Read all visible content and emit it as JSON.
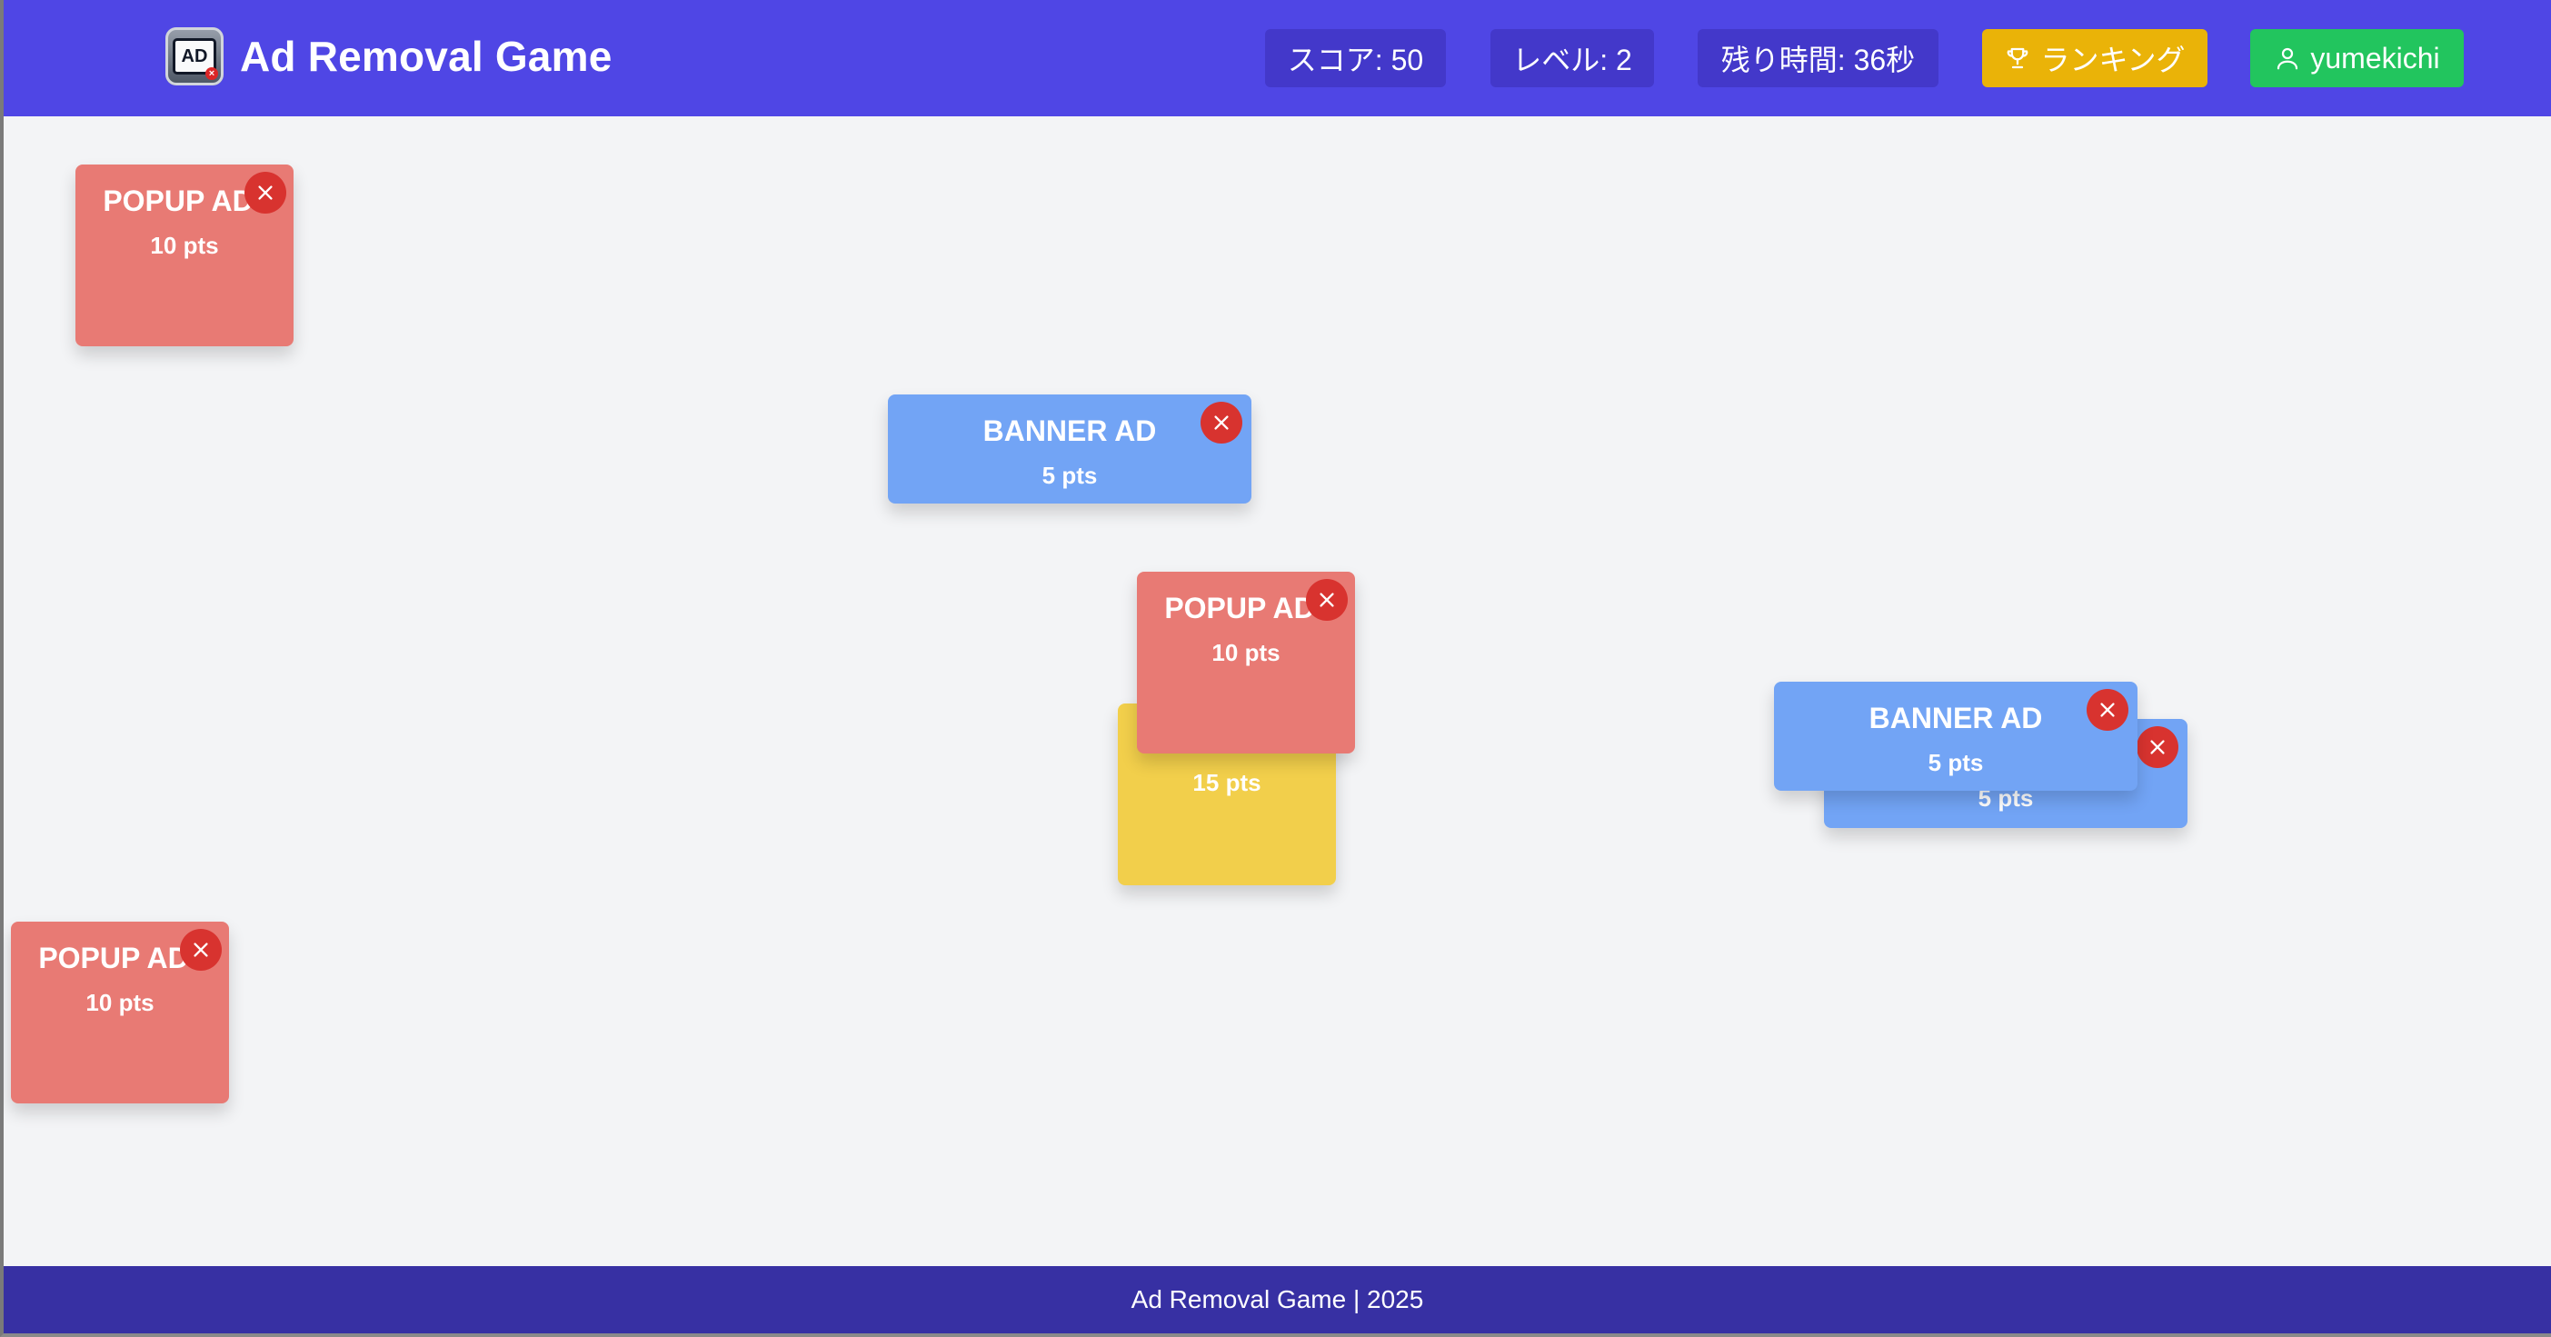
{
  "header": {
    "title": "Ad Removal Game",
    "logo_text": "AD",
    "score": "スコア: 50",
    "level": "レベル: 2",
    "time_left": "残り時間: 36秒",
    "ranking_label": "ランキング",
    "username": "yumekichi",
    "colors": {
      "bar": "#4f46e5",
      "stat_bg": "#4338ca",
      "ranking": "#eab308",
      "user": "#22c55e"
    }
  },
  "ads": {
    "popup1": {
      "title": "POPUP AD",
      "points": "10 pts"
    },
    "banner1": {
      "title": "BANNER AD",
      "points": "5 pts"
    },
    "special": {
      "points": "15 pts"
    },
    "popup2": {
      "title": "POPUP AD",
      "points": "10 pts"
    },
    "banner_back": {
      "points": "5 pts"
    },
    "banner2": {
      "title": "BANNER AD",
      "points": "5 pts"
    },
    "popup3": {
      "title": "POPUP AD",
      "points": "10 pts"
    },
    "colors": {
      "popup": "#e87a74",
      "banner": "#72a4f5",
      "special": "#f2cf4b",
      "close": "#d8332f"
    }
  },
  "footer": {
    "text": "Ad Removal Game | 2025"
  }
}
